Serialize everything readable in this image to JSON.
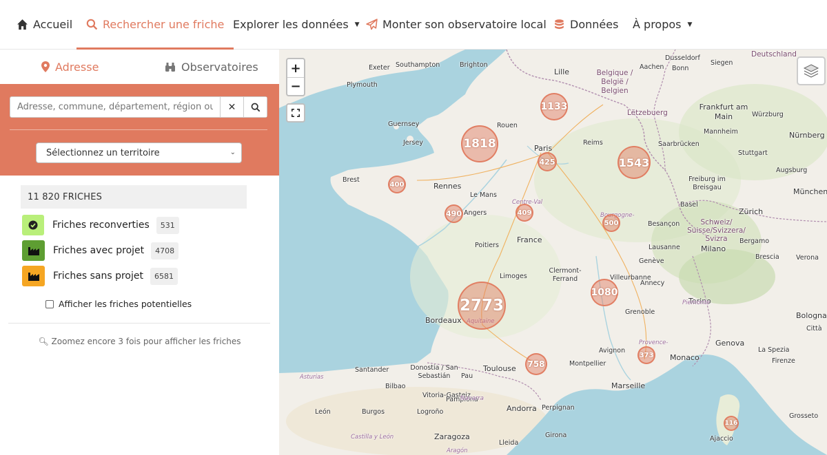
{
  "nav": {
    "home": "Accueil",
    "search": "Rechercher une friche",
    "explore": "Explorer les données",
    "observatory": "Monter son observatoire local",
    "data": "Données",
    "about": "À propos"
  },
  "sidebar": {
    "tab_address": "Adresse",
    "tab_observatories": "Observatoires",
    "search_placeholder": "Adresse, commune, département, région ou pa",
    "territory_select": "Sélectionnez un territoire",
    "total_count": "11 820 FRICHES",
    "legend": [
      {
        "label": "Friches reconverties",
        "count": "531",
        "color": "#b9ef7a",
        "icon": "check-circle-icon"
      },
      {
        "label": "Friches avec projet",
        "count": "4708",
        "color": "#5e9e32",
        "icon": "factory-icon"
      },
      {
        "label": "Friches sans projet",
        "count": "6581",
        "color": "#f5a623",
        "icon": "factory-icon"
      }
    ],
    "show_potential": "Afficher les friches potentielles",
    "zoom_hint": "Zoomez encore 3 fois pour afficher les friches"
  },
  "map": {
    "zoom_in": "+",
    "zoom_out": "−",
    "clusters": [
      {
        "id": "c1133",
        "count": "1133"
      },
      {
        "id": "c1818",
        "count": "1818"
      },
      {
        "id": "c425",
        "count": "425"
      },
      {
        "id": "c1543",
        "count": "1543"
      },
      {
        "id": "c400",
        "count": "400"
      },
      {
        "id": "c490",
        "count": "490"
      },
      {
        "id": "c409",
        "count": "409"
      },
      {
        "id": "c500",
        "count": "500"
      },
      {
        "id": "c1080",
        "count": "1080"
      },
      {
        "id": "c2773",
        "count": "2773"
      },
      {
        "id": "c758",
        "count": "758"
      },
      {
        "id": "c373",
        "count": "373"
      },
      {
        "id": "c116",
        "count": "116"
      }
    ],
    "labels": {
      "exeter": "Exeter",
      "southampton": "Southampton",
      "brighton": "Brighton",
      "plymouth": "Plymouth",
      "lille": "Lille",
      "belgique": "Belgique / België / Belgien",
      "aachen": "Aachen",
      "bonn": "Bonn",
      "dusseldorf": "Dusseldorf",
      "siegen": "Siegen",
      "deutschland": "Deutschland",
      "letzebuerg": "Lëtzebuerg",
      "frankfurt": "Frankfurt am Main",
      "wurzburg": "Würzburg",
      "nurnberg": "Nürnberg",
      "mannheim": "Mannheim",
      "saarbrucken": "Saarbrücken",
      "stuttgart": "Stuttgart",
      "augsburg": "Augsburg",
      "munchen": "München",
      "freiburg": "Freiburg im Breisgau",
      "reims": "Reims",
      "paris": "Paris",
      "rouen": "Rouen",
      "guernsey": "Guernsey",
      "jersey": "Jersey",
      "brest": "Brest",
      "rennes": "Rennes",
      "lemans": "Le Mans",
      "angers": "Angers",
      "centreval": "Centre-Val",
      "poitiers": "Poitiers",
      "france": "France",
      "basel": "Basel",
      "zurich": "Zürich",
      "schweiz": "Schweiz/ Suisse/Svizzera/ Svizra",
      "besancon": "Besançon",
      "bourgogne": "Bourgogne-",
      "lausanne": "Lausanne",
      "geneve": "Genève",
      "limoges": "Limoges",
      "clermont": "Clermont-Ferrand",
      "villeurbanne": "Villeurbanne",
      "annecy": "Annecy",
      "grenoble": "Grenoble",
      "bordeaux": "Bordeaux",
      "aquitaine": "Aquitaine",
      "milano": "Milano",
      "bergamo": "Bergamo",
      "brescia": "Brescia",
      "verona": "Verona",
      "torino": "Torino",
      "piemonte": "Piemonte",
      "genova": "Genova",
      "bologna": "Bologna",
      "citta": "Città",
      "laspezia": "La Spezia",
      "firenze": "Firenze",
      "monaco": "Monaco",
      "avignon": "Avignon",
      "montpellier": "Montpellier",
      "toulouse": "Toulouse",
      "marseille": "Marseille",
      "provence": "Provence-",
      "santander": "Santander",
      "donostia": "Donostia / San Sebastián",
      "pau": "Pau",
      "asturias": "Asturias",
      "bilbao": "Bilbao",
      "vitoria": "Vitoria-Gasteiz",
      "pamplona": "Pamplona",
      "navarra": "Navarra",
      "leon": "León",
      "burgos": "Burgos",
      "logrono": "Logroño",
      "andorra": "Andorra",
      "perpignan": "Perpignan",
      "girona": "Girona",
      "zaragoza": "Zaragoza",
      "lleida": "Lleida",
      "castilla": "Castilla y León",
      "aragon": "Aragón",
      "ajaccio": "Ajaccio",
      "grosseto": "Grosseto"
    }
  }
}
